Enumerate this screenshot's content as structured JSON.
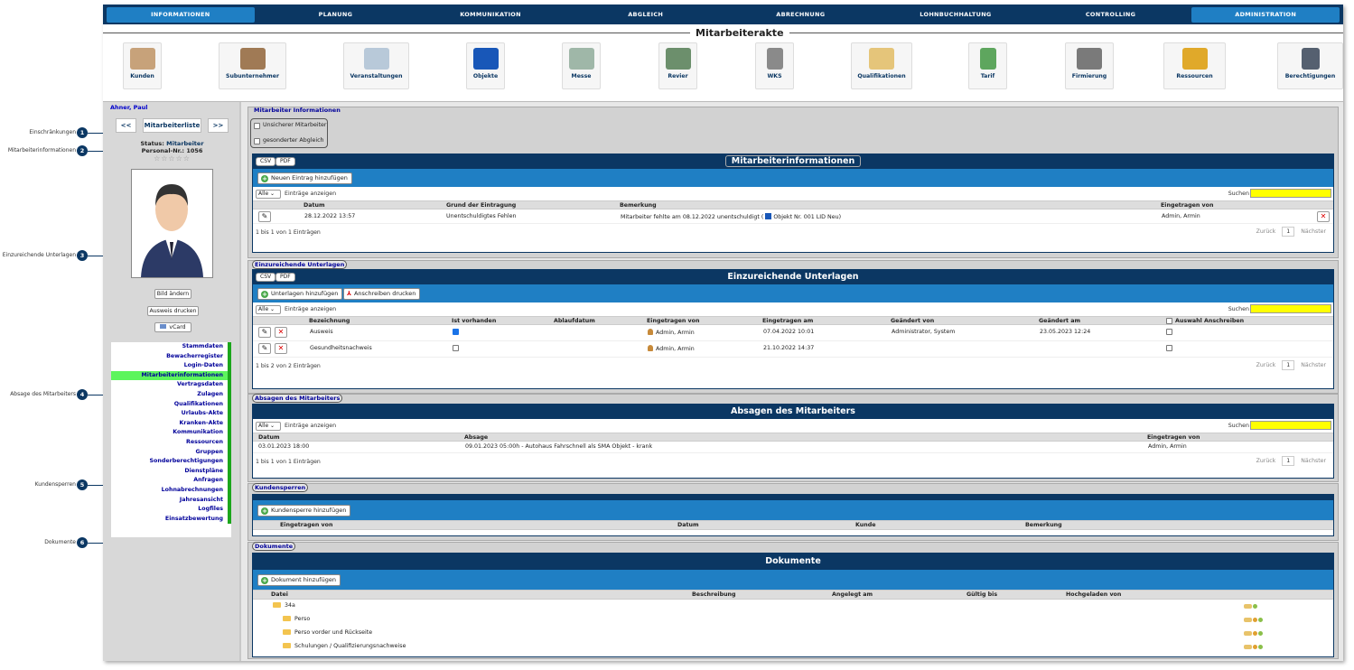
{
  "nav": {
    "items": [
      "INFORMATIONEN",
      "PLANUNG",
      "KOMMUNIKATION",
      "ABGLEICH",
      "ABRECHNUNG",
      "LOHNBUCHHALTUNG",
      "CONTROLLING",
      "ADMINISTRATION"
    ]
  },
  "header": {
    "title": "Mitarbeiterakte",
    "icons": [
      {
        "label": "Kunden",
        "icon": "handshake-icon"
      },
      {
        "label": "Subunternehmer",
        "icon": "people-icon"
      },
      {
        "label": "Veranstaltungen",
        "icon": "calendar-icon"
      },
      {
        "label": "Objekte",
        "icon": "cube-icon"
      },
      {
        "label": "Messe",
        "icon": "board-icon"
      },
      {
        "label": "Revier",
        "icon": "map-icon"
      },
      {
        "label": "WKS",
        "icon": "device-icon"
      },
      {
        "label": "Qualifikationen",
        "icon": "certificate-icon"
      },
      {
        "label": "Tarif",
        "icon": "tariff-icon"
      },
      {
        "label": "Firmierung",
        "icon": "phone-icon"
      },
      {
        "label": "Ressourcen",
        "icon": "boxes-icon"
      },
      {
        "label": "Berechtigungen",
        "icon": "user-key-icon"
      }
    ]
  },
  "callouts": [
    {
      "num": "1",
      "label": "Einschränkungen"
    },
    {
      "num": "2",
      "label": "Mitarbeiterinformationen"
    },
    {
      "num": "3",
      "label": "Einzureichende Unterlagen"
    },
    {
      "num": "4",
      "label": "Absage des Mitarbeiters"
    },
    {
      "num": "5",
      "label": "Kundensperren"
    },
    {
      "num": "6",
      "label": "Dokumente"
    }
  ],
  "sidebar": {
    "employee_name": "Ahner, Paul",
    "prev": "<<",
    "list": "Mitarbeiterliste",
    "next": ">>",
    "status_label": "Status:",
    "status_value": "Mitarbeiter",
    "personal_label": "Personal-Nr.:",
    "personal_value": "1056",
    "stars": "☆☆☆☆☆",
    "btn_image": "Bild ändern",
    "btn_id": "Ausweis drucken",
    "btn_vcard": "vCard",
    "menu": [
      "Stammdaten",
      "Bewacherregister",
      "Login-Daten",
      "Mitarbeiterinformationen",
      "Vertragsdaten",
      "Zulagen",
      "Qualifikationen",
      "Urlaubs-Akte",
      "Kranken-Akte",
      "Kommunikation",
      "Ressourcen",
      "Gruppen",
      "Sonderberechtigungen",
      "Dienstpläne",
      "Anfragen",
      "Lohnabrechnungen",
      "Jahresansicht",
      "Logfiles",
      "Einsatzbewertung"
    ],
    "menu_active_index": 3
  },
  "info": {
    "box_title": "Mitarbeiter Informationen",
    "checks": [
      "Unsicherer Mitarbeiter",
      "gesonderter Abgleich"
    ],
    "csv": "CSV",
    "pdf": "PDF",
    "panel_title": "Mitarbeiterinformationen",
    "add": "Neuen Eintrag hinzufügen",
    "select": "Alle",
    "select_hint": "Einträge anzeigen",
    "search": "Suchen",
    "columns": [
      "Datum",
      "Grund der Eintragung",
      "Bemerkung",
      "Eingetragen von"
    ],
    "row": {
      "date": "28.12.2022 13:57",
      "reason": "Unentschuldigtes Fehlen",
      "remark": "Mitarbeiter fehlte am 08.12.2022 unentschuldigt (",
      "object": "Objekt Nr. 001 LID Neu)",
      "by": "Admin, Armin"
    },
    "footer": "1 bis 1 von 1 Einträgen",
    "prev": "Zurück",
    "page": "1",
    "next": "Nächster"
  },
  "docs_required": {
    "box_title": "Einzureichende Unterlagen",
    "csv": "CSV",
    "pdf": "PDF",
    "panel_title": "Einzureichende Unterlagen",
    "add": "Unterlagen hinzufügen",
    "print": "Anschreiben drucken",
    "select": "Alle",
    "select_hint": "Einträge anzeigen",
    "search": "Suchen",
    "columns": [
      "Bezeichnung",
      "Ist vorhanden",
      "Ablaufdatum",
      "Eingetragen von",
      "Eingetragen am",
      "Geändert von",
      "Geändert am",
      "Auswahl Anschreiben"
    ],
    "rows": [
      {
        "name": "Ausweis",
        "present": true,
        "expiry": "",
        "by": "Admin, Armin",
        "at": "07.04.2022 10:01",
        "changed_by": "Administrator, System",
        "changed_at": "23.05.2023 12:24"
      },
      {
        "name": "Gesundheitsnachweis",
        "present": false,
        "expiry": "",
        "by": "Admin, Armin",
        "at": "21.10.2022 14:37",
        "changed_by": "",
        "changed_at": ""
      }
    ],
    "footer": "1 bis 2 von 2 Einträgen",
    "prev": "Zurück",
    "page": "1",
    "next": "Nächster"
  },
  "absagen": {
    "box_title": "Absagen des Mitarbeiters",
    "panel_title": "Absagen des Mitarbeiters",
    "select": "Alle",
    "select_hint": "Einträge anzeigen",
    "search": "Suchen",
    "columns": [
      "Datum",
      "Absage",
      "Eingetragen von"
    ],
    "row": {
      "date": "03.01.2023 18:00",
      "text": "09.01.2023 05:00h - Autohaus Fahrschnell als SMA Objekt - krank",
      "by": "Admin, Armin"
    },
    "footer": "1 bis 1 von 1 Einträgen",
    "prev": "Zurück",
    "page": "1",
    "next": "Nächster"
  },
  "sperren": {
    "box_title": "Kundensperren",
    "add": "Kundensperre hinzufügen",
    "columns": [
      "Eingetragen von",
      "Datum",
      "Kunde",
      "Bemerkung"
    ]
  },
  "dokumente": {
    "box_title": "Dokumente",
    "panel_title": "Dokumente",
    "add": "Dokument hinzufügen",
    "columns": [
      "Datei",
      "Beschreibung",
      "Angelegt am",
      "Gültig bis",
      "Hochgeladen von"
    ],
    "folders": [
      "34a",
      "Perso",
      "Perso vorder und Rückseite",
      "Schulungen / Qualifizierungsnachweise"
    ]
  },
  "colors": {
    "nav": "#0b3763",
    "nav_active": "#1f7fc4",
    "bar": "#1f7fc4",
    "active_menu": "#5df55d",
    "search": "#ffff00",
    "menu_marker": "#1ca61c"
  }
}
